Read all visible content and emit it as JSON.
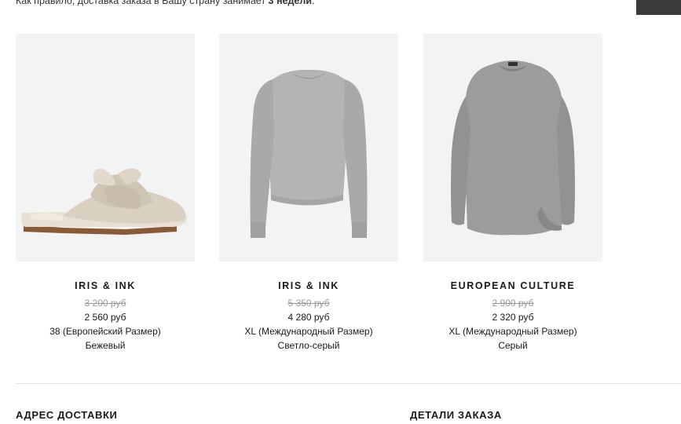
{
  "notice": {
    "prefix": "Как правило, доставка заказа в Вашу страну занимает ",
    "bold": "3 недели",
    "suffix": "."
  },
  "products": [
    {
      "brand": "IRIS & INK",
      "old_price": "3 200 руб",
      "new_price": "2 560 руб",
      "size": "38 (Европейский Размер)",
      "color": "Бежевый"
    },
    {
      "brand": "IRIS & INK",
      "old_price": "5 350 руб",
      "new_price": "4 280 руб",
      "size": "XL (Международный Размер)",
      "color": "Светло-серый"
    },
    {
      "brand": "EUROPEAN CULTURE",
      "old_price": "2 900 руб",
      "new_price": "2 320 руб",
      "size": "XL (Международный Размер)",
      "color": "Серый"
    }
  ],
  "sections": {
    "shipping_address": "АДРЕС ДОСТАВКИ",
    "order_details": "ДЕТАЛИ ЗАКАЗА"
  }
}
